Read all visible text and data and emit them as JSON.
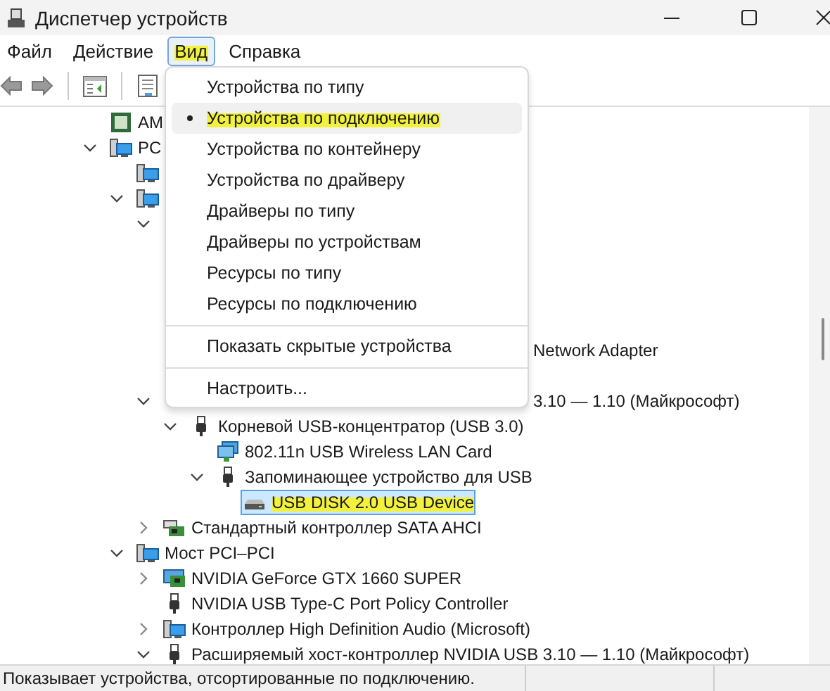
{
  "window": {
    "title": "Диспетчер устройств"
  },
  "menubar": [
    {
      "label": "Файл",
      "selected": false,
      "highlighted": false
    },
    {
      "label": "Действие",
      "selected": false,
      "highlighted": false
    },
    {
      "label": "Вид",
      "selected": true,
      "highlighted": true
    },
    {
      "label": "Справка",
      "selected": false,
      "highlighted": false
    }
  ],
  "tree": [
    {
      "kind": "chip",
      "text": "AM",
      "selected": false,
      "highlighted": false
    },
    {
      "kind": "computer",
      "text": "PC",
      "expanded": true,
      "selected": false,
      "highlighted": false,
      "children": [
        {
          "kind": "computer"
        },
        {
          "kind": "computer",
          "expanded": true,
          "children": [
            {
              "kind": "covered",
              "expanded": true,
              "children": [
                {
                  "kind": "covered",
                  "text": "Network Adapter"
                }
              ]
            },
            {
              "kind": "covered",
              "text": "3.10 — 1.10 (Майкрософт)",
              "expanded": true,
              "children": [
                {
                  "kind": "usb",
                  "text": "Корневой USB-концентратор (USB 3.0)",
                  "expanded": true,
                  "selected": false,
                  "highlighted": false,
                  "children": [
                    {
                      "kind": "network",
                      "text": "802.11n USB Wireless LAN Card",
                      "selected": false,
                      "highlighted": false
                    },
                    {
                      "kind": "usb",
                      "text": "Запоминающее устройство для USB",
                      "expanded": true,
                      "selected": false,
                      "highlighted": false,
                      "children": [
                        {
                          "kind": "disk",
                          "text": "USB DISK 2.0 USB Device",
                          "selected": true,
                          "highlighted": true
                        }
                      ]
                    }
                  ]
                }
              ]
            },
            {
              "kind": "controller",
              "text": "Стандартный контроллер SATA AHCI",
              "expanded": false,
              "selected": false,
              "highlighted": false
            }
          ]
        },
        {
          "kind": "computer",
          "text": "Мост PCI–PCI",
          "expanded": true,
          "selected": false,
          "highlighted": false,
          "children": [
            {
              "kind": "display",
              "text": "NVIDIA GeForce GTX 1660 SUPER",
              "expanded": false,
              "selected": false,
              "highlighted": false
            },
            {
              "kind": "usb",
              "text": "NVIDIA USB Type-C Port Policy Controller",
              "selected": false,
              "highlighted": false
            },
            {
              "kind": "computer",
              "text": "Контроллер High Definition Audio (Microsoft)",
              "expanded": false,
              "selected": false,
              "highlighted": false
            },
            {
              "kind": "usb",
              "text": "Расширяемый хост-контроллер NVIDIA USB 3.10 — 1.10 (Майкрософт)",
              "expanded": true,
              "selected": false,
              "highlighted": false
            }
          ]
        }
      ]
    }
  ],
  "view_menu": {
    "items": [
      {
        "kind": "item",
        "label": "Устройства по типу",
        "selected": false,
        "highlighted": false
      },
      {
        "kind": "item",
        "label": "Устройства по подключению",
        "selected": true,
        "highlighted": true
      },
      {
        "kind": "item",
        "label": "Устройства по контейнеру",
        "selected": false,
        "highlighted": false
      },
      {
        "kind": "item",
        "label": "Устройства по драйверу",
        "selected": false,
        "highlighted": false
      },
      {
        "kind": "item",
        "label": "Драйверы по типу",
        "selected": false,
        "highlighted": false
      },
      {
        "kind": "item",
        "label": "Драйверы по устройствам",
        "selected": false,
        "highlighted": false
      },
      {
        "kind": "item",
        "label": "Ресурсы по типу",
        "selected": false,
        "highlighted": false
      },
      {
        "kind": "item",
        "label": "Ресурсы по подключению",
        "selected": false,
        "highlighted": false
      },
      {
        "kind": "separator"
      },
      {
        "kind": "item",
        "label": "Показать скрытые устройства",
        "selected": false,
        "highlighted": false
      },
      {
        "kind": "separator"
      },
      {
        "kind": "item",
        "label": "Настроить...",
        "selected": false,
        "highlighted": false
      }
    ]
  },
  "status_bar": {
    "text": "Показывает устройства, отсортированные по подключению."
  }
}
